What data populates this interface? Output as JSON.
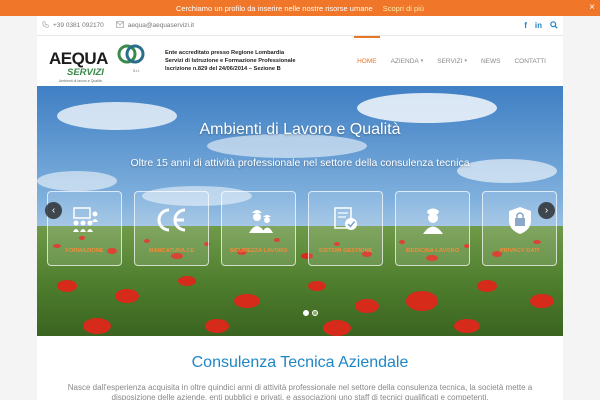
{
  "promo": {
    "text": "Cerchiamo un profilo da inserire nelle nostre risorse umane",
    "link": "Scopri di più",
    "close": "×"
  },
  "topbar": {
    "phone": "+39 0381 092170",
    "email": "aequa@aequaservizi.it",
    "social": [
      "f",
      "in"
    ],
    "icons": [
      "phone-icon",
      "mail-icon",
      "facebook-icon",
      "linkedin-icon",
      "search-icon"
    ]
  },
  "logo": {
    "word": "AEQUA",
    "word2": "SERVIZI",
    "srl": "S.r.l.",
    "tagline": "Ambienti di lavoro e Qualità"
  },
  "registration": {
    "line1": "Ente accreditato presso Regione Lombardia",
    "line2": "Servizi di Istruzione e Formazione Professionale",
    "line3": "Iscrizione n.829 del 24/06/2014 – Sezione B"
  },
  "nav": {
    "items": [
      {
        "label": "HOME",
        "active": true,
        "dropdown": false
      },
      {
        "label": "AZIENDA",
        "active": false,
        "dropdown": true
      },
      {
        "label": "SERVIZI",
        "active": false,
        "dropdown": true
      },
      {
        "label": "NEWS",
        "active": false,
        "dropdown": false
      },
      {
        "label": "CONTATTI",
        "active": false,
        "dropdown": false
      }
    ]
  },
  "hero": {
    "title": "Ambienti di Lavoro e Qualità",
    "subtitle": "Oltre 15 anni di attività professionale nel settore della consulenza tecnica",
    "boxes": [
      {
        "label": "FORMAZIONE",
        "icon": "training-people-icon"
      },
      {
        "label": "MARCATURA CE",
        "icon": "ce-mark-icon"
      },
      {
        "label": "SICUREZZA LAVORO",
        "icon": "workers-safety-icon"
      },
      {
        "label": "SISTEMI GESTIONE",
        "icon": "certificate-badge-icon"
      },
      {
        "label": "MEDICINA LAVORO",
        "icon": "nurse-icon"
      },
      {
        "label": "PRIVACY DATI",
        "icon": "lock-shield-icon"
      }
    ],
    "prev": "‹",
    "next": "›",
    "slides_count": 2,
    "active_slide": 1
  },
  "content": {
    "title": "Consulenza Tecnica Aziendale",
    "text": "Nasce dall'esperienza acquisita in oltre quindici anni di attività professionale nel settore della consulenza tecnica, la società mette a disposizione delle aziende, enti pubblici e privati, e associazioni uno staff di tecnici qualificati e competenti."
  },
  "colors": {
    "accent": "#f0762a",
    "brand_blue": "#1e86c6",
    "box_label": "#f08c3a"
  }
}
